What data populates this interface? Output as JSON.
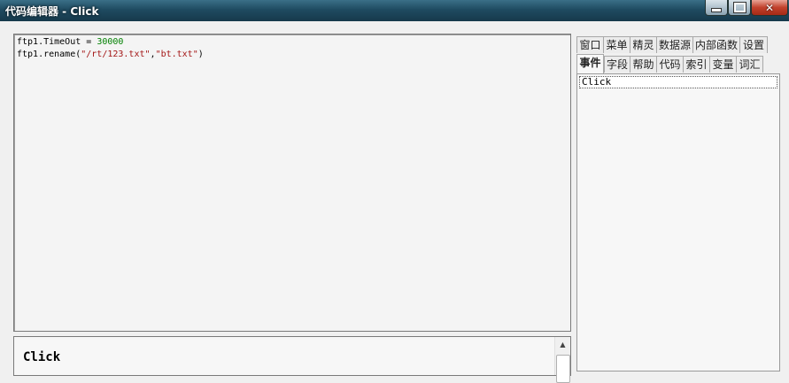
{
  "window": {
    "title": "代码编辑器 - Click",
    "controls": {
      "minimize": "minimize",
      "maximize": "maximize",
      "close": "✕"
    }
  },
  "editor": {
    "lines": [
      [
        {
          "t": "ftp1.TimeOut = ",
          "c": "plain"
        },
        {
          "t": "30000",
          "c": "num"
        }
      ],
      [
        {
          "t": "ftp1.rename(",
          "c": "plain"
        },
        {
          "t": "\"/rt/123.txt\"",
          "c": "str"
        },
        {
          "t": ",",
          "c": "plain"
        },
        {
          "t": "\"bt.txt\"",
          "c": "str"
        },
        {
          "t": ")",
          "c": "plain"
        }
      ]
    ]
  },
  "output": {
    "text": "Click"
  },
  "tabs": {
    "row1": [
      "窗口",
      "菜单",
      "精灵",
      "数据源",
      "内部函数",
      "设置"
    ],
    "row2": [
      "事件",
      "字段",
      "帮助",
      "代码",
      "索引",
      "变量",
      "词汇"
    ],
    "active": "事件"
  },
  "events": {
    "items": [
      "Click"
    ],
    "selected": "Click"
  }
}
